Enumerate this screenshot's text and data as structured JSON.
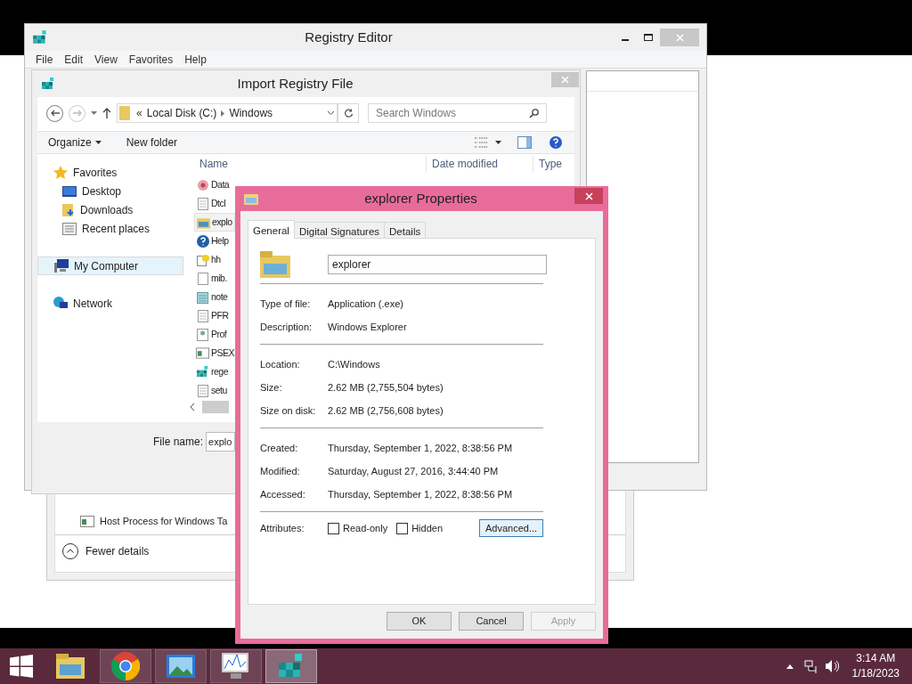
{
  "registry_editor": {
    "title": "Registry Editor",
    "menu": [
      "File",
      "Edit",
      "View",
      "Favorites",
      "Help"
    ]
  },
  "import_dialog": {
    "title": "Import Registry File",
    "address_overflow": "«",
    "address": [
      "Local Disk (C:)",
      "Windows"
    ],
    "search_placeholder": "Search Windows",
    "toolbar": [
      "Organize",
      "New folder"
    ],
    "nav": [
      {
        "label": "Favorites",
        "kind": "favorites",
        "selected": false,
        "children": [
          {
            "label": "Desktop",
            "kind": "desktop",
            "selected": false
          },
          {
            "label": "Downloads",
            "kind": "downloads",
            "selected": false
          },
          {
            "label": "Recent places",
            "kind": "recent",
            "selected": false
          }
        ]
      },
      {
        "label": "My Computer",
        "kind": "computer",
        "selected": true
      },
      {
        "label": "Network",
        "kind": "network",
        "selected": false
      }
    ],
    "columns": [
      "Name",
      "Date modified",
      "Type"
    ],
    "files": [
      {
        "name": "Data",
        "kind": "gear",
        "selected": false
      },
      {
        "name": "Dtcl",
        "kind": "text",
        "selected": false
      },
      {
        "name": "explo",
        "kind": "folder",
        "selected": true
      },
      {
        "name": "Help",
        "kind": "help",
        "selected": false
      },
      {
        "name": "hh",
        "kind": "helpdoc",
        "selected": false
      },
      {
        "name": "mib.",
        "kind": "blank",
        "selected": false
      },
      {
        "name": "note",
        "kind": "notepad",
        "selected": false
      },
      {
        "name": "PFR",
        "kind": "text",
        "selected": false
      },
      {
        "name": "Prof",
        "kind": "config",
        "selected": false
      },
      {
        "name": "PSEX",
        "kind": "app",
        "selected": false
      },
      {
        "name": "rege",
        "kind": "registry",
        "selected": false
      },
      {
        "name": "setu",
        "kind": "text",
        "selected": false
      }
    ],
    "file_name_label": "File name:",
    "file_name": "explo"
  },
  "task_manager": {
    "rows": [
      {
        "name": "Host Process for Windows Ta"
      }
    ],
    "toggle": "Fewer details"
  },
  "properties": {
    "title": "explorer Properties",
    "tabs": [
      {
        "label": "General",
        "selected": true
      },
      {
        "label": "Digital Signatures",
        "selected": false
      },
      {
        "label": "Details",
        "selected": false
      }
    ],
    "name": "explorer",
    "groups": [
      [
        {
          "label": "Type of file:",
          "value": "Application (.exe)"
        },
        {
          "label": "Description:",
          "value": "Windows Explorer"
        }
      ],
      [
        {
          "label": "Location:",
          "value": "C:\\Windows"
        },
        {
          "label": "Size:",
          "value": "2.62 MB (2,755,504 bytes)"
        },
        {
          "label": "Size on disk:",
          "value": "2.62 MB (2,756,608 bytes)"
        }
      ],
      [
        {
          "label": "Created:",
          "value": "Thursday, September 1, 2022, 8:38:56 PM"
        },
        {
          "label": "Modified:",
          "value": "Saturday, August 27, 2016, 3:44:40 PM"
        },
        {
          "label": "Accessed:",
          "value": "Thursday, September 1, 2022, 8:38:56 PM"
        }
      ]
    ],
    "attributes_label": "Attributes:",
    "attributes": [
      {
        "label": "Read-only",
        "checked": false
      },
      {
        "label": "Hidden",
        "checked": false
      }
    ],
    "advanced": "Advanced...",
    "buttons": [
      {
        "label": "OK",
        "disabled": false
      },
      {
        "label": "Cancel",
        "disabled": false
      },
      {
        "label": "Apply",
        "disabled": true
      }
    ]
  },
  "taskbar": {
    "apps": [
      {
        "kind": "explorer",
        "selected": false
      },
      {
        "kind": "chrome",
        "selected": false
      },
      {
        "kind": "photos",
        "selected": false
      },
      {
        "kind": "monitor",
        "selected": false
      },
      {
        "kind": "registry",
        "selected": true
      }
    ],
    "time": "3:14 AM",
    "date": "1/18/2023"
  }
}
